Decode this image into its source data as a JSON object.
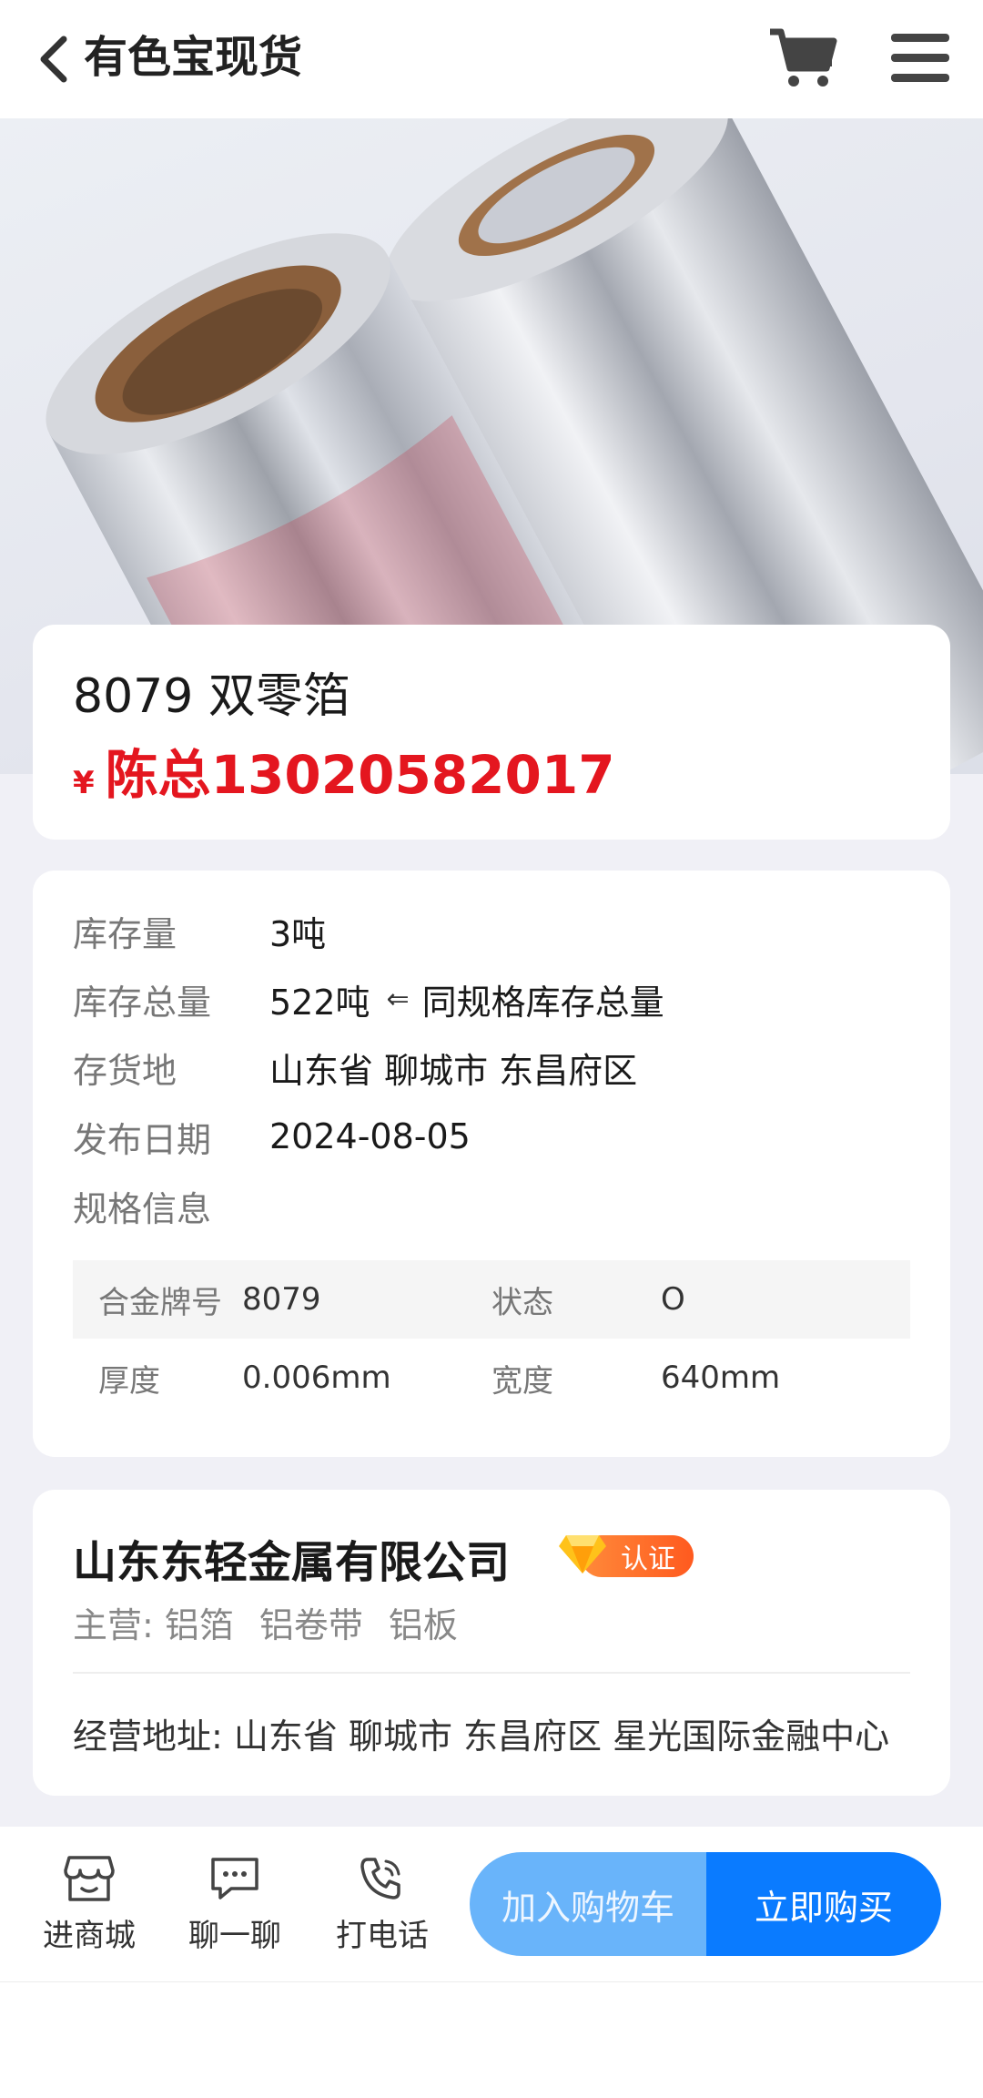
{
  "header": {
    "title": "有色宝现货",
    "back_icon": "chevron-left-icon",
    "cart_icon": "shopping-cart-icon",
    "menu_icon": "hamburger-menu-icon"
  },
  "product": {
    "name": "8079 双零箔",
    "price_symbol": "¥",
    "price_text": "陈总13020582017"
  },
  "info": {
    "stock_label": "库存量",
    "stock_value": "3吨",
    "total_label": "库存总量",
    "total_value": "522吨",
    "total_arrow": "⇐",
    "total_note": "同规格库存总量",
    "location_label": "存货地",
    "location_value": "山东省 聊城市 东昌府区",
    "date_label": "发布日期",
    "date_value": "2024-08-05",
    "spec_label": "规格信息"
  },
  "spec_table": [
    {
      "k1": "合金牌号",
      "v1": "8079",
      "k2": "状态",
      "v2": "O"
    },
    {
      "k1": "厚度",
      "v1": "0.006mm",
      "k2": "宽度",
      "v2": "640mm"
    }
  ],
  "company": {
    "name": "山东东轻金属有限公司",
    "badge": "认证",
    "main_label": "主营:",
    "products": [
      "铝箔",
      "铝卷带",
      "铝板"
    ],
    "address": "经营地址: 山东省 聊城市 东昌府区 星光国际金融中心"
  },
  "bottom_bar": {
    "store_label": "进商城",
    "chat_label": "聊一聊",
    "phone_label": "打电话",
    "add_cart_label": "加入购物车",
    "buy_label": "立即购买"
  },
  "colors": {
    "price": "#e4161f",
    "primary": "#0a7bff",
    "secondary": "#69b4fa",
    "badge": "#ff6a2a"
  }
}
